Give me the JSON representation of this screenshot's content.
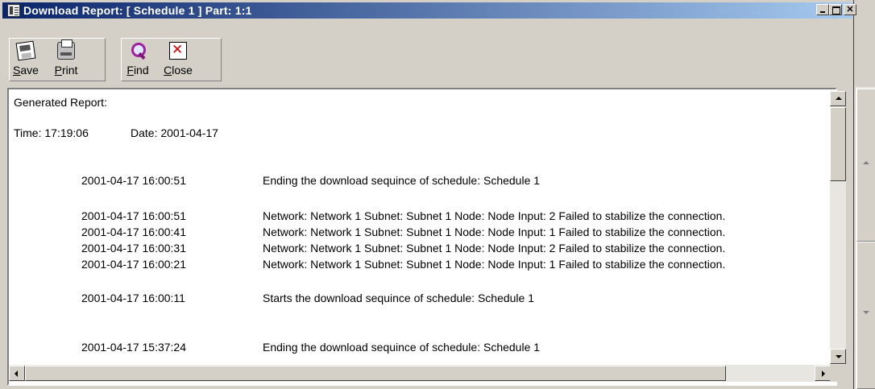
{
  "window": {
    "title": "Download Report: [ Schedule 1 ]  Part: 1:1",
    "minimize": "_",
    "maximize": "□",
    "close": "✕"
  },
  "toolbar": {
    "save_label": "Save",
    "save_mnemonic": "S",
    "save_rest": "ave",
    "print_label": "Print",
    "print_mnemonic": "P",
    "print_rest": "rint",
    "find_label": "Find",
    "find_mnemonic": "F",
    "find_rest": "ind",
    "close_label": "Close",
    "close_mnemonic": "C",
    "close_rest": "lose"
  },
  "report": {
    "header": "Generated Report:",
    "time_label": "Time: 17:19:06",
    "date_label": "Date: 2001-04-17",
    "entries": [
      {
        "timestamp": "2001-04-17 16:00:51",
        "message": "Ending the download sequince of schedule: Schedule 1"
      },
      {
        "timestamp": "2001-04-17 16:00:51",
        "message": "Network: Network 1 Subnet: Subnet 1 Node: Node  Input: 2 Failed to stabilize the connection."
      },
      {
        "timestamp": "2001-04-17 16:00:41",
        "message": "Network: Network 1 Subnet: Subnet 1 Node: Node  Input: 1 Failed to stabilize the connection."
      },
      {
        "timestamp": "2001-04-17 16:00:31",
        "message": "Network: Network 1 Subnet: Subnet 1 Node: Node  Input: 2 Failed to stabilize the connection."
      },
      {
        "timestamp": "2001-04-17 16:00:21",
        "message": "Network: Network 1 Subnet: Subnet 1 Node: Node  Input: 1 Failed to stabilize the connection."
      },
      {
        "timestamp": "2001-04-17 16:00:11",
        "message": "Starts the download sequince of schedule: Schedule 1"
      },
      {
        "timestamp": "2001-04-17 15:37:24",
        "message": "Ending the download sequince of schedule: Schedule 1"
      }
    ]
  },
  "colors": {
    "titlebar_start": "#0a246a",
    "titlebar_end": "#a6caf0",
    "face": "#d4d0c8"
  }
}
